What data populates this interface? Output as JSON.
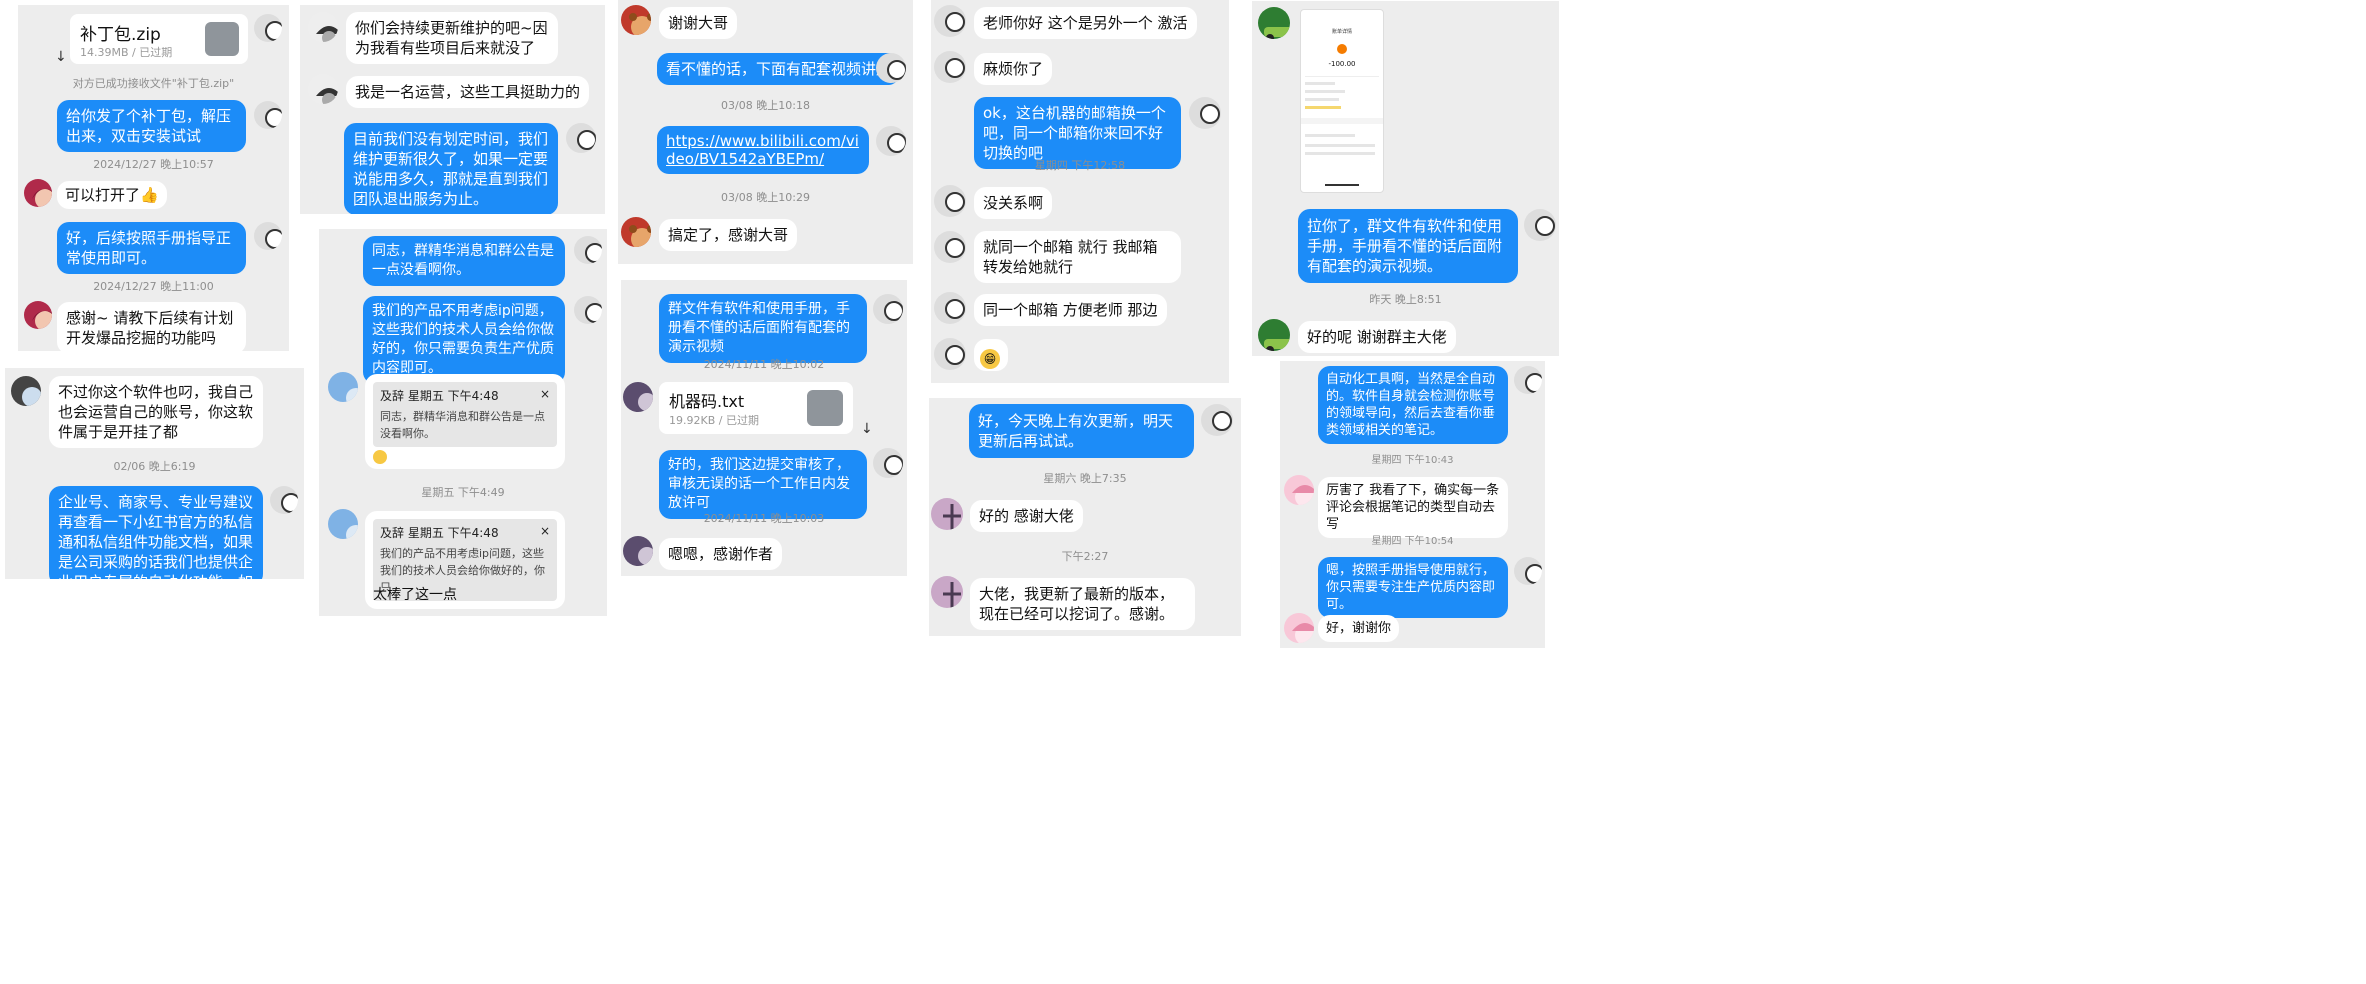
{
  "colors": {
    "panel_bg": "#ededed",
    "bubble_blue": "#1c8cf8",
    "bubble_white": "#ffffff",
    "timestamp": "#8e8e8e"
  },
  "icons": [
    "avatar-icon",
    "file-icon",
    "download-icon",
    "emoji-icon",
    "close-icon"
  ],
  "p1": {
    "file_name": "补丁包.zip",
    "file_meta": "14.39MB / 已过期",
    "download_icon": "↓",
    "receipt": "对方已成功接收文件\"补丁包.zip\"",
    "msg1": "给你发了个补丁包，解压出来，双击安装试试",
    "time1": "2024/12/27 晚上10:57",
    "msg2": "可以打开了👍",
    "msg3": "好，后续按照手册指导正常使用即可。",
    "time2": "2024/12/27 晚上11:00",
    "msg4": "感谢~ 请教下后续有计划开发爆品挖掘的功能吗"
  },
  "p2": {
    "msg1": "不过你这个软件也叼，我自己也会运营自己的账号，你这软件属于是开挂了都",
    "time1": "02/06 晚上6:19",
    "msg2": "企业号、商家号、专业号建议再查看一下小红书官方的私信通和私信组件功能文档，如果是公司采购的话我们也提供企业用户专属的自动化功能，如聚光后台自动投放、"
  },
  "p3": {
    "msg1": "你们会持续更新维护的吧~因为我看有些项目后来就没了",
    "msg2": "我是一名运营，这些工具挺助力的",
    "msg3": "目前我们没有划定时间，我们维护更新很久了，如果一定要说能用多久，那就是直到我们团队退出服务为止。"
  },
  "p4": {
    "msg1": "同志，群精华消息和群公告是一点没看啊你。",
    "msg2": "我们的产品不用考虑ip问题，这些我们的技术人员会给你做好的，你只需要负责生产优质内容即可。",
    "quote1_header": "及辞 星期五 下午4:48",
    "quote_close": "×",
    "quote1_text": "同志，群精华消息和群公告是一点没看啊你。",
    "time1": "星期五 下午4:49",
    "quote2_header": "及辞 星期五 下午4:48",
    "quote2_text": "我们的产品不用考虑ip问题，这些我们的技术人员会给你做好的，你只…",
    "reply2": "太棒了这一点"
  },
  "p5": {
    "msg1": "谢谢大哥",
    "msg2": "看不懂的话，下面有配套视频讲解",
    "time1": "03/08 晚上10:18",
    "link": "https://www.bilibili.com/video/BV1542aYBEPm/",
    "time2": "03/08 晚上10:29",
    "msg3": "搞定了，感谢大哥"
  },
  "p6": {
    "msg1": "群文件有软件和使用手册，手册看不懂的话后面附有配套的演示视频",
    "time1": "2024/11/11 晚上10:02",
    "file_name": "机器码.txt",
    "file_meta": "19.92KB / 已过期",
    "msg2": "好的，我们这边提交审核了，审核无误的话一个工作日内发放许可",
    "time2": "2024/11/11 晚上10:03",
    "msg3": "嗯嗯，感谢作者"
  },
  "p7": {
    "msg1": "老师你好  这个是另外一个 激活",
    "msg2": "麻烦你了",
    "msg3": "ok，这台机器的邮箱换一个吧，同一个邮箱你来回不好切换的吧",
    "time1": "星期四 下午12:58",
    "msg4": "没关系啊",
    "msg5": "就同一个邮箱 就行 我邮箱转发给她就行",
    "msg6": "同一个邮箱 方便老师 那边",
    "emoji": "😁"
  },
  "p8": {
    "msg1": "好，今天晚上有次更新，明天更新后再试试。",
    "time1": "星期六 晚上7:35",
    "msg2": "好的 感谢大佬",
    "time2": "下午2:27",
    "msg3": "大佬，我更新了最新的版本，现在已经可以挖词了。感谢。"
  },
  "p9": {
    "phone_title": "账单详情",
    "phone_amount": "-100.00",
    "msg1": "拉你了，群文件有软件和使用手册，手册看不懂的话后面附有配套的演示视频。",
    "time1": "昨天 晚上8:51",
    "msg2": "好的呢 谢谢群主大佬"
  },
  "p10": {
    "msg1": "自动化工具啊，当然是全自动的。软件自身就会检测你账号的领域导向，然后去查看你垂类领域相关的笔记。",
    "time1": "星期四 下午10:43",
    "msg2": "厉害了 我看了下，确实每一条评论会根据笔记的类型自动去写",
    "time2": "星期四 下午10:54",
    "msg3": "嗯，按照手册指导使用就行，你只需要专注生产优质内容即可。",
    "msg4": "好，谢谢你"
  }
}
